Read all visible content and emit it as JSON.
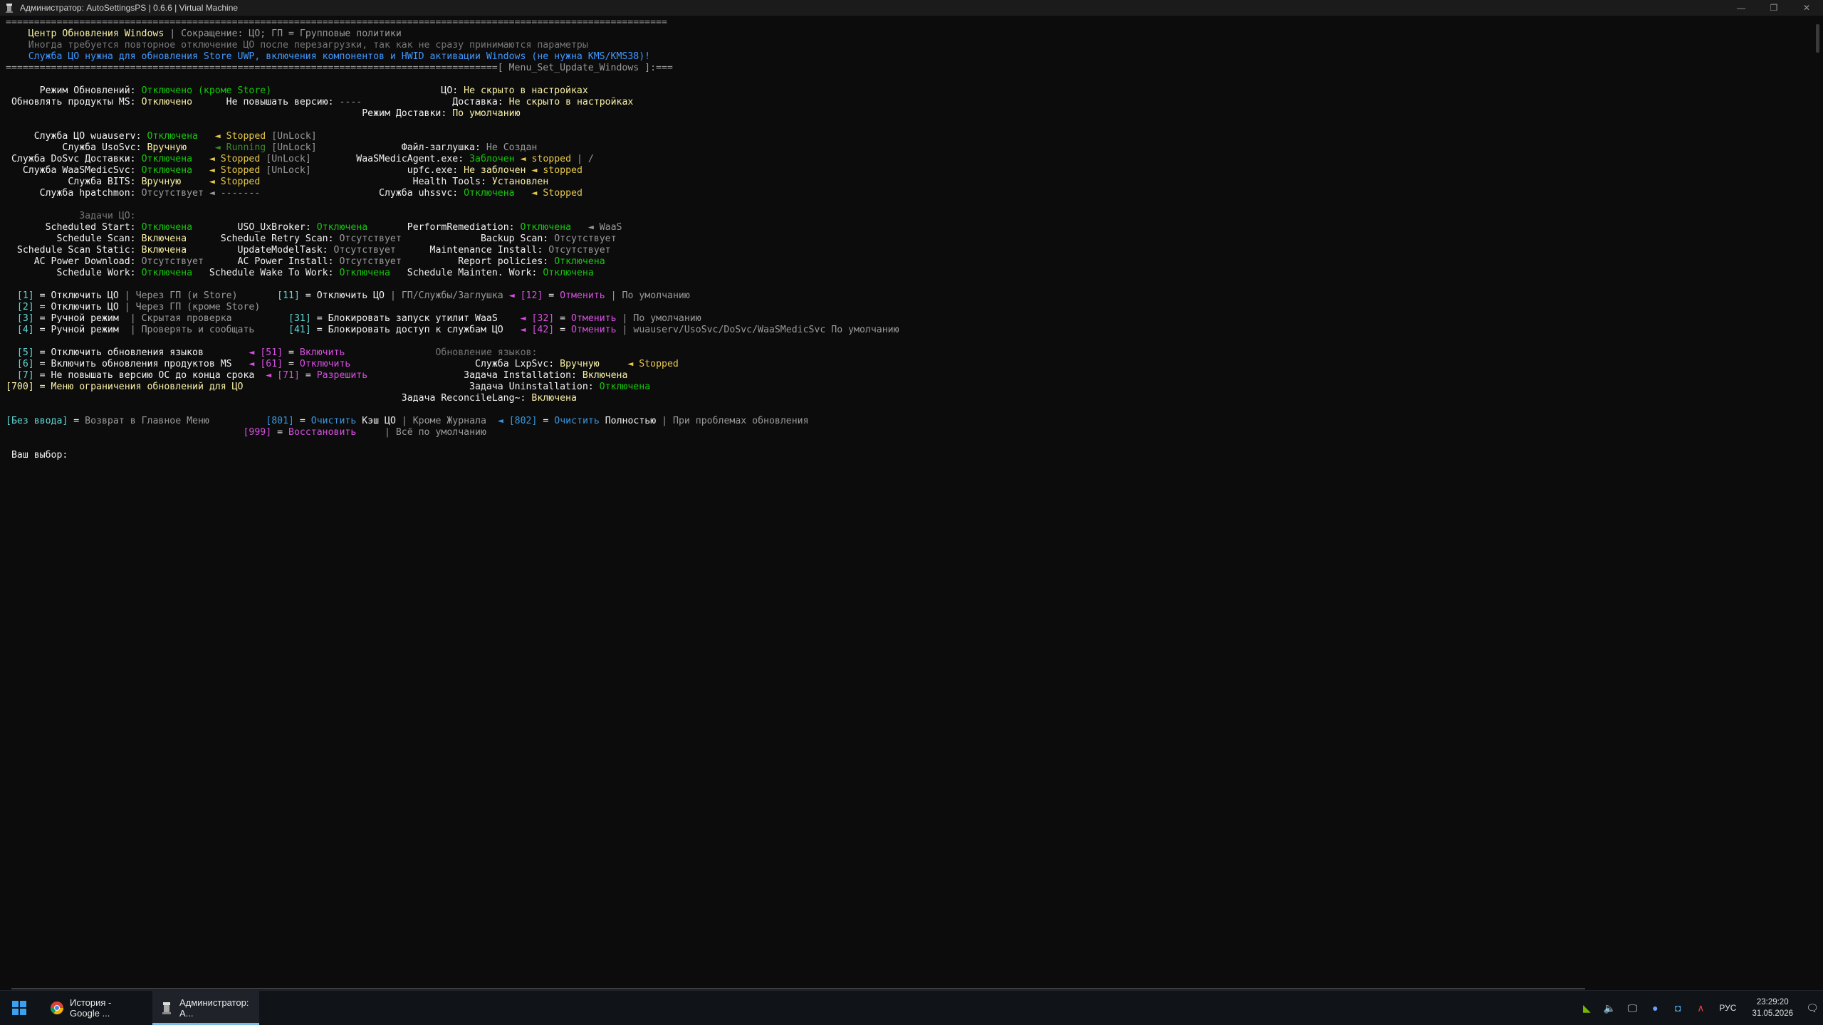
{
  "window": {
    "title": "Администратор: AutoSettingsPS | 0.6.6 | Virtual Machine",
    "minimize_glyph": "—",
    "maximize_glyph": "❐",
    "close_glyph": "✕"
  },
  "palette": {
    "white": "#f2f2f2",
    "gray": "#9a9a9a",
    "dim": "#767676",
    "yellow": "#f9f1a5",
    "gold": "#e6c84b",
    "amber": "#c19c00",
    "green": "#16c60c",
    "darkgreen": "#3a8a2a",
    "cyan": "#3a96dd",
    "teal": "#61d6d6",
    "magenta": "#d64fe0",
    "blue": "#4098ff",
    "bright": "#ffffff"
  },
  "console_lines": [
    [
      [
        "=====================================================================================================================",
        "gray"
      ]
    ],
    [
      [
        "    ",
        "gray"
      ],
      [
        "Центр Обновления Windows",
        "yellow"
      ],
      [
        " | Сокращение: ЦО; ГП = Групповые политики",
        "gray"
      ]
    ],
    [
      [
        "    Иногда требуется повторное отключение ЦО после перезагрузки, так как не сразу принимаются параметры",
        "dim"
      ]
    ],
    [
      [
        "    Служба ЦО нужна для обновления Store UWP, включения компонентов и HWID активации Windows (не нужна KMS/KMS38)!",
        "blue"
      ]
    ],
    [
      [
        "=======================================================================================[ Menu_Set_Update_Windows ]:===",
        "gray"
      ]
    ],
    [
      [
        "",
        "gray"
      ]
    ],
    [
      [
        "      Режим Обновлений: ",
        "white"
      ],
      [
        "Отключено (кроме Store)",
        "green"
      ],
      [
        "                              ЦО: ",
        "white"
      ],
      [
        "Не скрыто в настройках",
        "yellow"
      ]
    ],
    [
      [
        " Обновлять продукты MS: ",
        "white"
      ],
      [
        "Отключено",
        "yellow"
      ],
      [
        "      Не повышать версию: ",
        "white"
      ],
      [
        "----",
        "gray"
      ],
      [
        "                Доставка: ",
        "white"
      ],
      [
        "Не скрыто в настройках",
        "yellow"
      ]
    ],
    [
      [
        "                                                               Режим Доставки: ",
        "white"
      ],
      [
        "По умолчанию",
        "yellow"
      ]
    ],
    [
      [
        "",
        "gray"
      ]
    ],
    [
      [
        "     Служба ЦО wuauserv: ",
        "white"
      ],
      [
        "Отключена",
        "green"
      ],
      [
        "   ◄ ",
        "gold"
      ],
      [
        "Stopped",
        "gold"
      ],
      [
        " [UnLock]",
        "gray"
      ]
    ],
    [
      [
        "          Служба UsoSvc: ",
        "white"
      ],
      [
        "Вручную",
        "yellow"
      ],
      [
        "     ◄ ",
        "darkgreen"
      ],
      [
        "Running",
        "darkgreen"
      ],
      [
        " [UnLock]",
        "gray"
      ],
      [
        "               Файл-заглушка: ",
        "white"
      ],
      [
        "Не Создан",
        "gray"
      ]
    ],
    [
      [
        " Служба DoSvc Доставки: ",
        "white"
      ],
      [
        "Отключена",
        "green"
      ],
      [
        "   ◄ ",
        "gold"
      ],
      [
        "Stopped",
        "gold"
      ],
      [
        " [UnLock]",
        "gray"
      ],
      [
        "        WaaSMedicAgent.exe: ",
        "white"
      ],
      [
        "Заблочен",
        "green"
      ],
      [
        " ◄ ",
        "gold"
      ],
      [
        "stopped",
        "gold"
      ],
      [
        " | /",
        "gray"
      ]
    ],
    [
      [
        "   Служба WaaSMedicSvc: ",
        "white"
      ],
      [
        "Отключена",
        "green"
      ],
      [
        "   ◄ ",
        "gold"
      ],
      [
        "Stopped",
        "gold"
      ],
      [
        " [UnLock]",
        "gray"
      ],
      [
        "                 upfc.exe: ",
        "white"
      ],
      [
        "Не заблочен",
        "yellow"
      ],
      [
        " ◄ ",
        "gold"
      ],
      [
        "stopped",
        "gold"
      ]
    ],
    [
      [
        "           Служба BITS: ",
        "white"
      ],
      [
        "Вручную",
        "yellow"
      ],
      [
        "     ◄ ",
        "gold"
      ],
      [
        "Stopped",
        "gold"
      ],
      [
        "                           Health Tools: ",
        "white"
      ],
      [
        "Установлен",
        "yellow"
      ]
    ],
    [
      [
        "      Служба hpatchmon: ",
        "white"
      ],
      [
        "Отсутствует",
        "gray"
      ],
      [
        " ◄ -------",
        "gray"
      ],
      [
        "                     Служба uhssvc: ",
        "white"
      ],
      [
        "Отключена",
        "green"
      ],
      [
        "   ◄ ",
        "gold"
      ],
      [
        "Stopped",
        "gold"
      ]
    ],
    [
      [
        "",
        "gray"
      ]
    ],
    [
      [
        "             ",
        "gray"
      ],
      [
        "Задачи ЦО:",
        "dim"
      ]
    ],
    [
      [
        "       Scheduled Start: ",
        "white"
      ],
      [
        "Отключена",
        "green"
      ],
      [
        "        USO_UxBroker: ",
        "white"
      ],
      [
        "Отключена",
        "green"
      ],
      [
        "       PerformRemediation: ",
        "white"
      ],
      [
        "Отключена",
        "green"
      ],
      [
        "   ◄ WaaS",
        "gray"
      ]
    ],
    [
      [
        "         Schedule Scan: ",
        "white"
      ],
      [
        "Включена",
        "yellow"
      ],
      [
        "      Schedule Retry Scan: ",
        "white"
      ],
      [
        "Отсутствует",
        "gray"
      ],
      [
        "              Backup Scan: ",
        "white"
      ],
      [
        "Отсутствует",
        "gray"
      ]
    ],
    [
      [
        "  Schedule Scan Static: ",
        "white"
      ],
      [
        "Включена",
        "yellow"
      ],
      [
        "         UpdateModelTask: ",
        "white"
      ],
      [
        "Отсутствует",
        "gray"
      ],
      [
        "      Maintenance Install: ",
        "white"
      ],
      [
        "Отсутствует",
        "gray"
      ]
    ],
    [
      [
        "     AC Power Download: ",
        "white"
      ],
      [
        "Отсутствует",
        "gray"
      ],
      [
        "      AC Power Install: ",
        "white"
      ],
      [
        "Отсутствует",
        "gray"
      ],
      [
        "          Report policies: ",
        "white"
      ],
      [
        "Отключена",
        "green"
      ]
    ],
    [
      [
        "         Schedule Work: ",
        "white"
      ],
      [
        "Отключена",
        "green"
      ],
      [
        "   Schedule Wake To Work: ",
        "white"
      ],
      [
        "Отключена",
        "green"
      ],
      [
        "   Schedule Mainten. Work: ",
        "white"
      ],
      [
        "Отключена",
        "green"
      ]
    ],
    [
      [
        "",
        "gray"
      ]
    ],
    [
      [
        "  ",
        "gray"
      ],
      [
        "[1]",
        "teal"
      ],
      [
        " = Отключить ЦО ",
        "white"
      ],
      [
        "| Через ГП (и Store)",
        "gray"
      ],
      [
        "       ",
        "gray"
      ],
      [
        "[11]",
        "teal"
      ],
      [
        " = Отключить ЦО ",
        "white"
      ],
      [
        "| ГП/Службы/Заглушка ",
        "gray"
      ],
      [
        "◄ ",
        "magenta"
      ],
      [
        "[12]",
        "magenta"
      ],
      [
        " = ",
        "white"
      ],
      [
        "Отменить",
        "magenta"
      ],
      [
        " | По умолчанию",
        "gray"
      ]
    ],
    [
      [
        "  ",
        "gray"
      ],
      [
        "[2]",
        "teal"
      ],
      [
        " = Отключить ЦО ",
        "white"
      ],
      [
        "| Через ГП (кроме Store)",
        "gray"
      ]
    ],
    [
      [
        "  ",
        "gray"
      ],
      [
        "[3]",
        "teal"
      ],
      [
        " = Ручной режим  ",
        "white"
      ],
      [
        "| Скрытая проверка",
        "gray"
      ],
      [
        "          ",
        "gray"
      ],
      [
        "[31]",
        "teal"
      ],
      [
        " = Блокировать запуск утилит WaaS    ",
        "white"
      ],
      [
        "◄ ",
        "magenta"
      ],
      [
        "[32]",
        "magenta"
      ],
      [
        " = ",
        "white"
      ],
      [
        "Отменить",
        "magenta"
      ],
      [
        " | По умолчанию",
        "gray"
      ]
    ],
    [
      [
        "  ",
        "gray"
      ],
      [
        "[4]",
        "teal"
      ],
      [
        " = Ручной режим  ",
        "white"
      ],
      [
        "| Проверять и сообщать",
        "gray"
      ],
      [
        "      ",
        "gray"
      ],
      [
        "[41]",
        "teal"
      ],
      [
        " = Блокировать доступ к службам ЦО   ",
        "white"
      ],
      [
        "◄ ",
        "magenta"
      ],
      [
        "[42]",
        "magenta"
      ],
      [
        " = ",
        "white"
      ],
      [
        "Отменить",
        "magenta"
      ],
      [
        " | wuauserv/UsoSvc/DoSvc/WaaSMedicSvc По умолчанию",
        "gray"
      ]
    ],
    [
      [
        "",
        "gray"
      ]
    ],
    [
      [
        "  ",
        "gray"
      ],
      [
        "[5]",
        "teal"
      ],
      [
        " = Отключить обновления языков        ",
        "white"
      ],
      [
        "◄ ",
        "magenta"
      ],
      [
        "[51]",
        "magenta"
      ],
      [
        " = ",
        "white"
      ],
      [
        "Включить",
        "magenta"
      ],
      [
        "                ",
        "gray"
      ],
      [
        "Обновление языков:",
        "dim"
      ]
    ],
    [
      [
        "  ",
        "gray"
      ],
      [
        "[6]",
        "teal"
      ],
      [
        " = Включить обновления продуктов MS   ",
        "white"
      ],
      [
        "◄ ",
        "magenta"
      ],
      [
        "[61]",
        "magenta"
      ],
      [
        " = ",
        "white"
      ],
      [
        "Отключить",
        "magenta"
      ],
      [
        "                      Служба LxpSvc: ",
        "white"
      ],
      [
        "Вручную",
        "yellow"
      ],
      [
        "     ◄ ",
        "gold"
      ],
      [
        "Stopped",
        "gold"
      ]
    ],
    [
      [
        "  ",
        "gray"
      ],
      [
        "[7]",
        "teal"
      ],
      [
        " = Не повышать версию ОС до конца срока  ",
        "white"
      ],
      [
        "◄ ",
        "magenta"
      ],
      [
        "[71]",
        "magenta"
      ],
      [
        " = ",
        "white"
      ],
      [
        "Разрешить",
        "magenta"
      ],
      [
        "                 Задача Installation: ",
        "white"
      ],
      [
        "Включена",
        "yellow"
      ]
    ],
    [
      [
        "[700]",
        "yellow"
      ],
      [
        " = Меню ограничения обновлений для ЦО",
        "yellow"
      ],
      [
        "                                        Задача Uninstallation: ",
        "white"
      ],
      [
        "Отключена",
        "green"
      ]
    ],
    [
      [
        "                                                                      Задача ReconcileLang~: ",
        "white"
      ],
      [
        "Включена",
        "yellow"
      ]
    ],
    [
      [
        "",
        "gray"
      ]
    ],
    [
      [
        "[Без ввода]",
        "teal"
      ],
      [
        " = ",
        "white"
      ],
      [
        "Возврат в Главное Меню",
        "gray"
      ],
      [
        "          ",
        "gray"
      ],
      [
        "[801]",
        "cyan"
      ],
      [
        " = ",
        "white"
      ],
      [
        "Очистить",
        "cyan"
      ],
      [
        " Кэш ЦО ",
        "white"
      ],
      [
        "| Кроме Журнала  ",
        "gray"
      ],
      [
        "◄ ",
        "cyan"
      ],
      [
        "[802]",
        "cyan"
      ],
      [
        " = ",
        "white"
      ],
      [
        "Очистить",
        "cyan"
      ],
      [
        " Полностью ",
        "white"
      ],
      [
        "| При проблемах обновления",
        "gray"
      ]
    ],
    [
      [
        "                                          ",
        "gray"
      ],
      [
        "[999]",
        "magenta"
      ],
      [
        " = ",
        "white"
      ],
      [
        "Восстановить",
        "magenta"
      ],
      [
        "     ",
        "gray"
      ],
      [
        "| Всё по умолчанию",
        "gray"
      ]
    ],
    [
      [
        "",
        "gray"
      ]
    ],
    [
      [
        " Ваш выбор: ",
        "white"
      ]
    ]
  ],
  "taskbar": {
    "tasks": [
      {
        "label": "История - Google ...",
        "icon": "chrome-icon",
        "active": false
      },
      {
        "label": "Администратор: A...",
        "icon": "terminal-app-icon",
        "active": true
      }
    ],
    "tray": {
      "icons": [
        "nvidia-icon",
        "volume-icon",
        "network-icon",
        "app-tray-icon-1",
        "app-tray-icon-2",
        "app-tray-icon-3"
      ],
      "language": "РУС",
      "time": "23:29:20",
      "date": "31.05.2026"
    }
  }
}
